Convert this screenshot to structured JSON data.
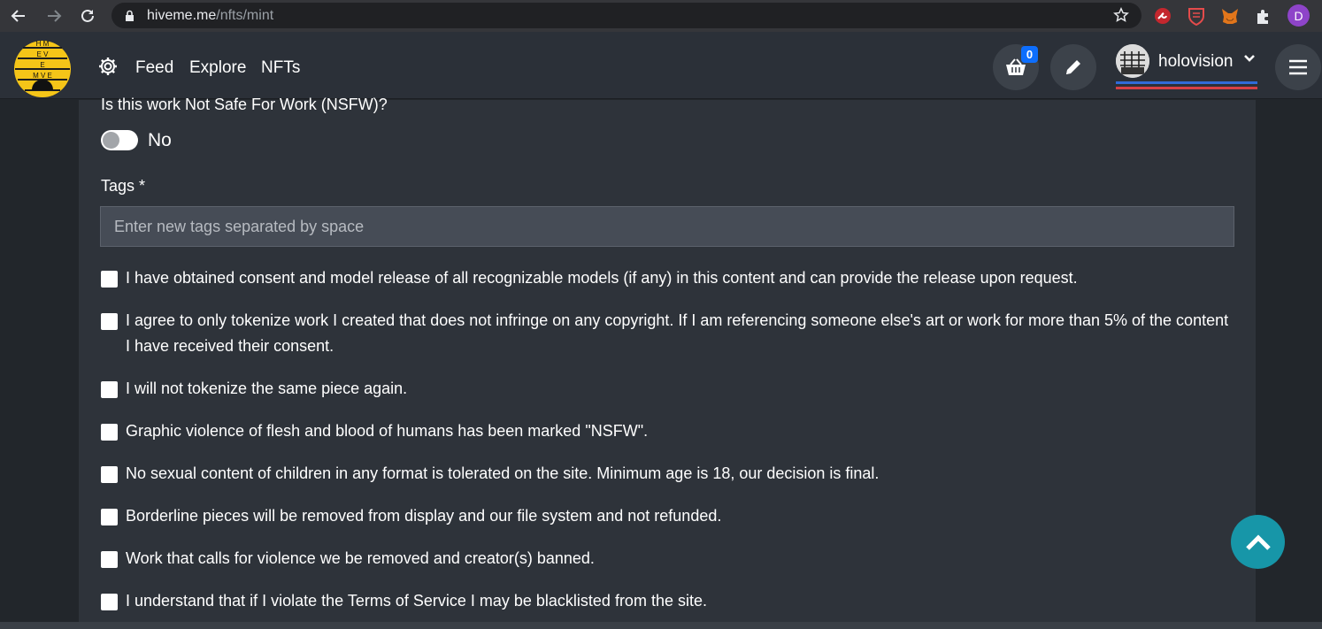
{
  "browser": {
    "url_host": "hiveme.me",
    "url_path": "/nfts/mint",
    "profile_initial": "D"
  },
  "header": {
    "nav": [
      "Feed",
      "Explore",
      "NFTs"
    ],
    "cart_count": "0",
    "username": "holovision",
    "logo_letters": [
      "H",
      "M",
      "E",
      "V",
      "E",
      "E",
      "M",
      "E"
    ]
  },
  "form": {
    "nsfw_question": "Is this work Not Safe For Work (NSFW)?",
    "nsfw_value": "No",
    "nsfw_enabled": false,
    "tags_label": "Tags *",
    "tags_placeholder": "Enter new tags separated by space",
    "tags_value": "",
    "agreements": [
      "I have obtained consent and model release of all recognizable models (if any) in this content and can provide the release upon request.",
      "I agree to only tokenize work I created that does not infringe on any copyright. If I am referencing someone else's art or work for more than 5% of the content I have received their consent.",
      "I will not tokenize the same piece again.",
      "Graphic violence of flesh and blood of humans has been marked \"NSFW\".",
      "No sexual content of children in any format is tolerated on the site. Minimum age is 18, our decision is final.",
      "Borderline pieces will be removed from display and our file system and not refunded.",
      "Work that calls for violence we be removed and creator(s) banned.",
      "I understand that if I violate the Terms of Service I may be blacklisted from the site."
    ]
  },
  "colors": {
    "accent": "#1796a8",
    "badge": "#0d6efd",
    "underline_blue": "#2f6bd8",
    "underline_red": "#d64045"
  }
}
